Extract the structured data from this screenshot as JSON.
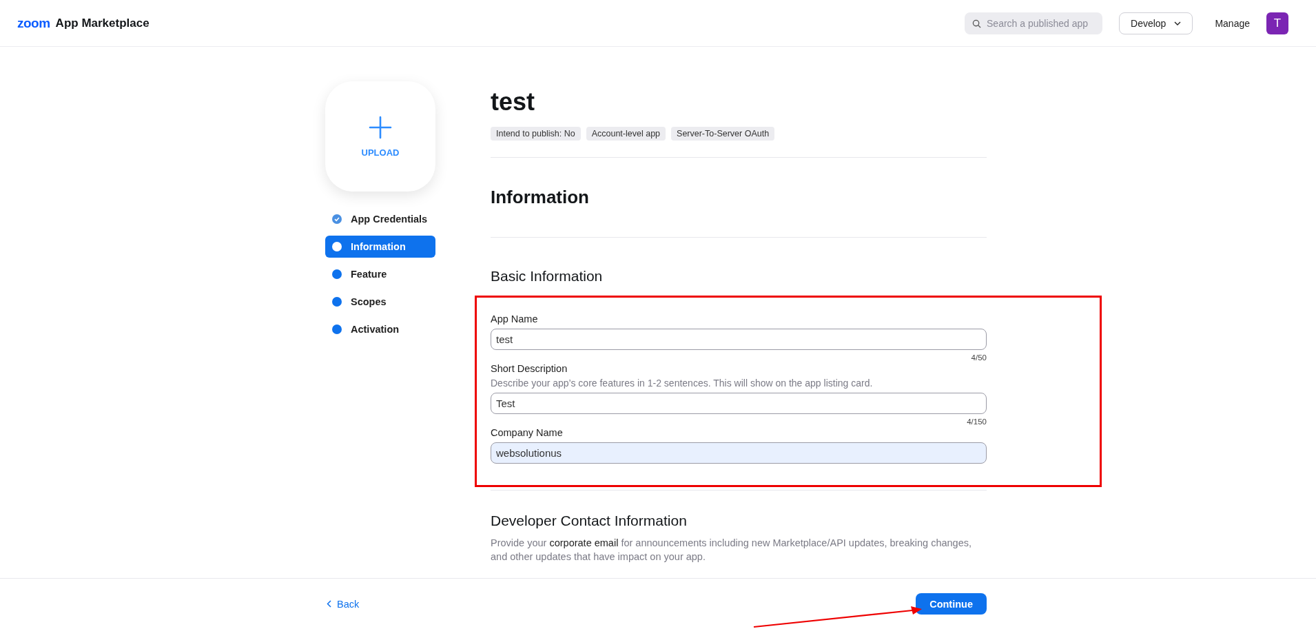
{
  "header": {
    "logo": "zoom",
    "product": "App Marketplace",
    "search": {
      "placeholder": "Search a published app"
    },
    "develop_menu": "Develop",
    "manage_link": "Manage",
    "avatar": "T"
  },
  "upload": {
    "label": "UPLOAD"
  },
  "steps": [
    {
      "label": "App Credentials",
      "completed": true,
      "selected": false
    },
    {
      "label": "Information",
      "completed": false,
      "selected": true
    },
    {
      "label": "Feature",
      "completed": false,
      "selected": false
    },
    {
      "label": "Scopes",
      "completed": false,
      "selected": false
    },
    {
      "label": "Activation",
      "completed": false,
      "selected": false
    }
  ],
  "app_title": "test",
  "tags": [
    "Intend to publish: No",
    "Account-level app",
    "Server-To-Server OAuth"
  ],
  "section_title": "Information",
  "basic_info": {
    "title": "Basic Information",
    "fields": [
      {
        "label": "App Name",
        "value": "test",
        "counter": "4/50",
        "autofilled": false
      },
      {
        "label": "Short Description",
        "hint": "Describe your app’s core features in 1-2 sentences. This will show on the app listing card.",
        "value": "Test",
        "counter": "4/150",
        "autofilled": false
      },
      {
        "label": "Company Name",
        "value": "websolutionus",
        "autofilled": true
      }
    ]
  },
  "developer_contact": {
    "title": "Developer Contact Information",
    "description": "Provide your **corporate email** for announcements including new Marketplace/API updates, breaking changes, and other updates that have impact on your app."
  },
  "footer": {
    "back": "Back",
    "continue": "Continue"
  },
  "annotations": {
    "highlight_box": true,
    "arrow": true
  }
}
